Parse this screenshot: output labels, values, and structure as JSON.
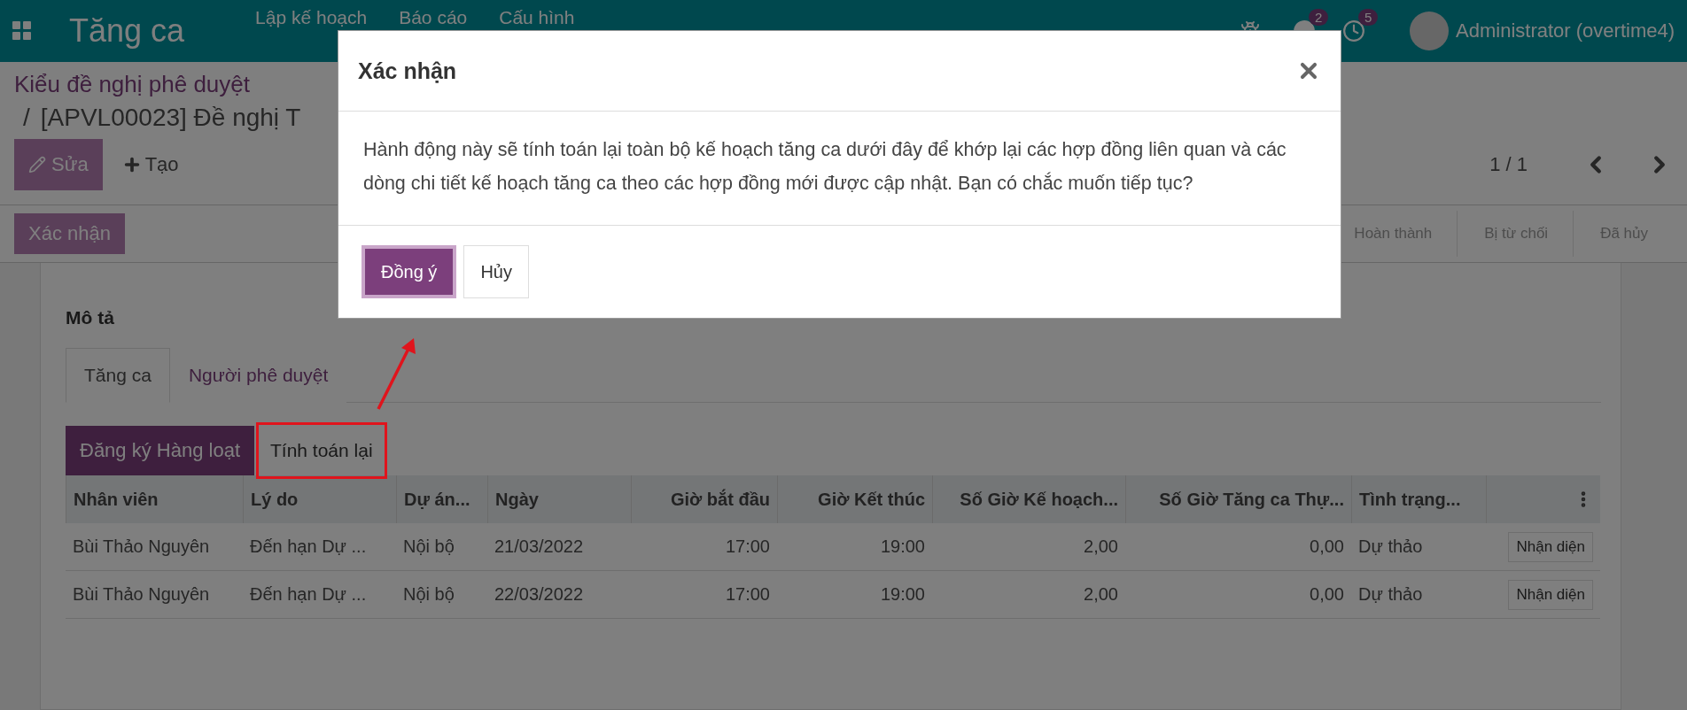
{
  "navbar": {
    "app_title": "Tăng ca",
    "menus": [
      "Lập kế hoạch",
      "Báo cáo",
      "Cấu hình"
    ],
    "notifications": [
      {
        "kind": "chat",
        "count": "2"
      },
      {
        "kind": "activity",
        "count": "5"
      }
    ],
    "user": "Administrator (overtime4)"
  },
  "breadcrumb": {
    "parent": "Kiểu đề nghị phê duyệt",
    "separator": "/",
    "current": "[APVL00023] Đề nghị T"
  },
  "actions": {
    "edit": "Sửa",
    "create": "Tạo"
  },
  "pager": {
    "value": "1 / 1"
  },
  "header_buttons": [
    "Xác nhận"
  ],
  "status_stages": [
    "Hoàn thành",
    "Bị từ chối",
    "Đã hủy"
  ],
  "form": {
    "section_title": "Mô tả",
    "tabs": [
      {
        "label": "Tăng ca",
        "selected": true
      },
      {
        "label": "Người phê duyệt",
        "selected": false
      }
    ],
    "buttons": [
      {
        "label": "Đăng ký Hàng loạt",
        "kind": "primary",
        "highlighted": false
      },
      {
        "label": "Tính toán lại",
        "kind": "secondary",
        "highlighted": true
      }
    ],
    "table": {
      "columns": [
        {
          "label": "Nhân viên",
          "kind": "text"
        },
        {
          "label": "Lý do",
          "kind": "text"
        },
        {
          "label": "Dự án...",
          "kind": "text"
        },
        {
          "label": "Ngày",
          "kind": "text"
        },
        {
          "label": "Giờ bắt đầu",
          "kind": "number"
        },
        {
          "label": "Giờ Kết thúc",
          "kind": "number"
        },
        {
          "label": "Số Giờ Kế hoạch...",
          "kind": "number"
        },
        {
          "label": "Số Giờ Tăng ca Thự...",
          "kind": "number"
        },
        {
          "label": "Tình trạng...",
          "kind": "text"
        }
      ],
      "rows": [
        {
          "cells": [
            "Bùi Thảo Nguyên",
            "Đến hạn Dự ...",
            "Nội bộ",
            "21/03/2022",
            "17:00",
            "19:00",
            "2,00",
            "0,00",
            "Dự thảo"
          ],
          "action": "Nhận diện"
        },
        {
          "cells": [
            "Bùi Thảo Nguyên",
            "Đến hạn Dự ...",
            "Nội bộ",
            "22/03/2022",
            "17:00",
            "19:00",
            "2,00",
            "0,00",
            "Dự thảo"
          ],
          "action": "Nhận diện"
        }
      ]
    }
  },
  "dialog": {
    "title": "Xác nhận",
    "message": "Hành động này sẽ tính toán lại toàn bộ kế hoạch tăng ca dưới đây để khớp lại các hợp đồng liên quan và các dòng chi tiết kế hoạch tăng ca theo các hợp đồng mới được cập nhật. Bạn có chắc muốn tiếp tục?",
    "buttons": [
      {
        "label": "Đồng ý",
        "kind": "primary",
        "focused": true
      },
      {
        "label": "Hủy",
        "kind": "secondary",
        "focused": false
      }
    ]
  }
}
